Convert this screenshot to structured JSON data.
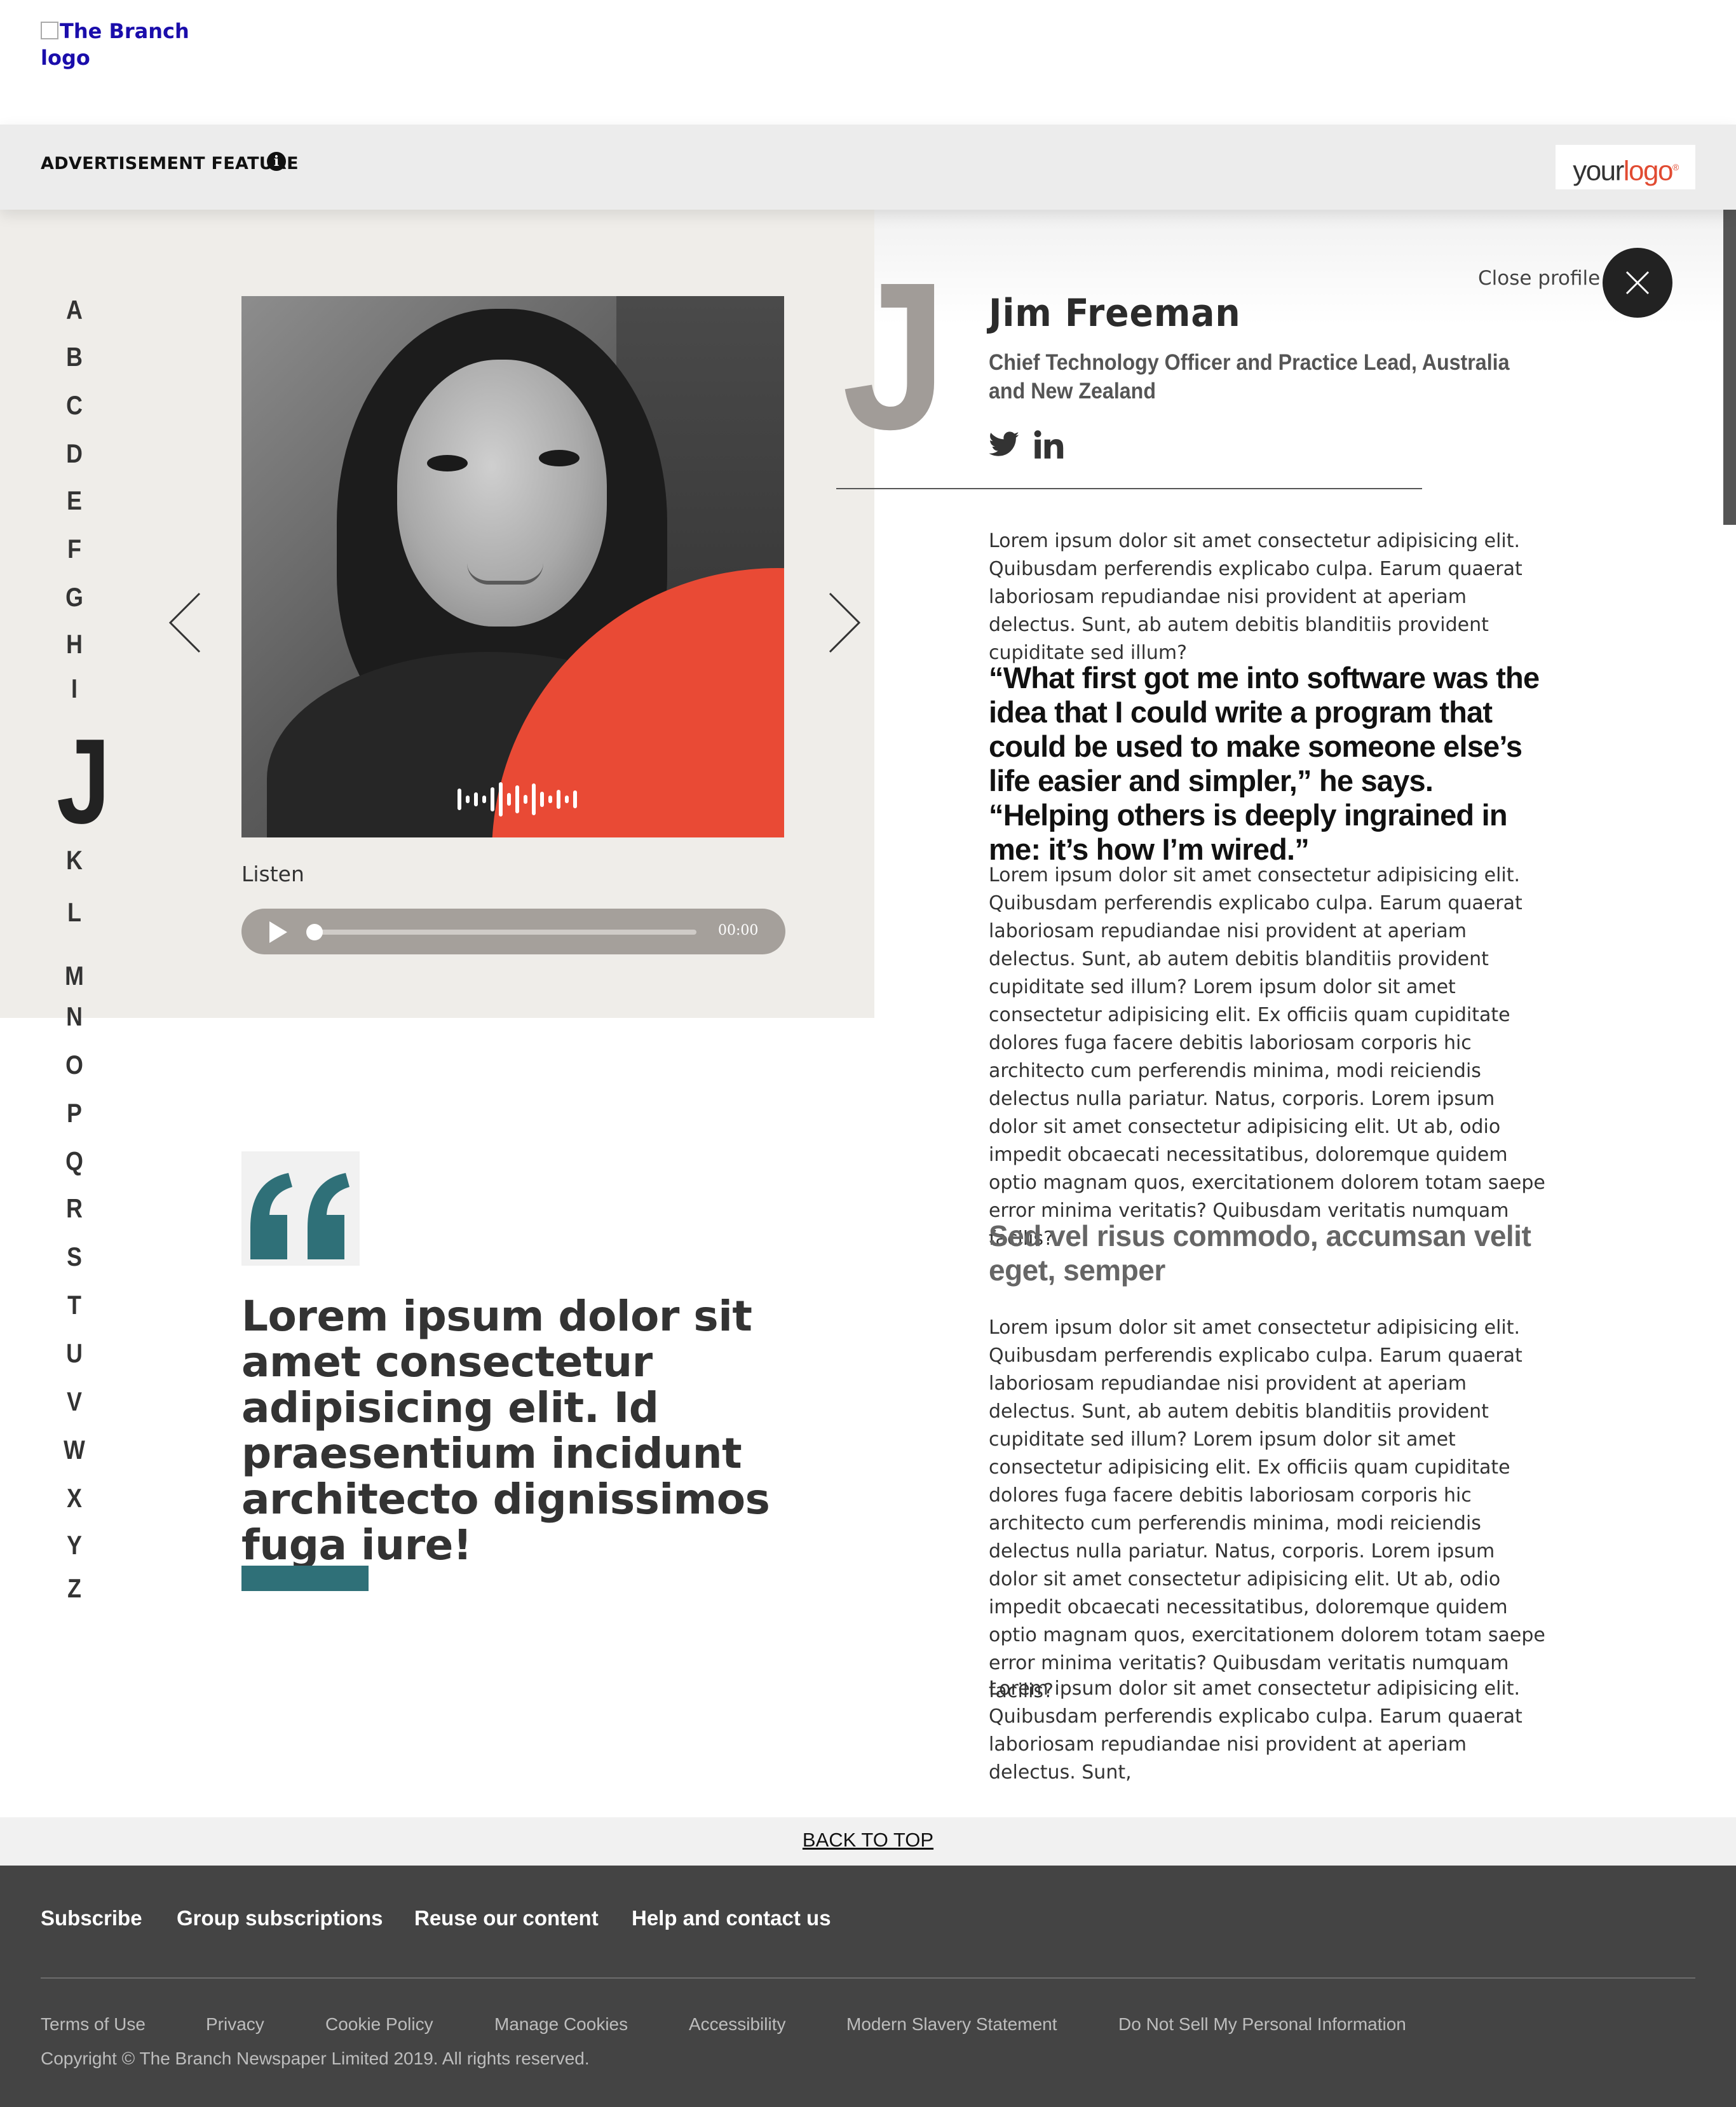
{
  "brand": {
    "logo_alt": "The Branch logo"
  },
  "adbar": {
    "label": "ADVERTISEMENT FEATURE",
    "info_icon": "i",
    "sponsor_logo_word1": "your",
    "sponsor_logo_word2": "logo",
    "sponsor_logo_mark": "®"
  },
  "alphabet": {
    "letters": [
      "A",
      "B",
      "C",
      "D",
      "E",
      "F",
      "G",
      "H",
      "I",
      "J",
      "K",
      "L",
      "M",
      "N",
      "O",
      "P",
      "Q",
      "R",
      "S",
      "T",
      "U",
      "V",
      "W",
      "X",
      "Y",
      "Z"
    ],
    "selected": "J"
  },
  "profile": {
    "initial": "J",
    "name": "Jim Freeman",
    "title": "Chief Technology Officer and Practice Lead, Australia and New Zealand",
    "close_label": "Close profile",
    "social_icons": [
      "twitter-icon",
      "linkedin-icon"
    ],
    "photo_accent_color": "#e94a35"
  },
  "audio": {
    "listen_label": "Listen",
    "time": "00:00",
    "progress": 0
  },
  "article": {
    "intro": "Lorem ipsum dolor sit amet consectetur adipisicing elit. Quibusdam perferendis explicabo culpa. Earum quaerat laboriosam repudiandae nisi provident at aperiam delectus. Sunt, ab autem debitis blanditiis provident cupiditate sed illum?",
    "quote": "“What first got me into software was the idea that I could write a program that could be used to make someone else’s life easier and simpler,” he says. “Helping others is deeply ingrained in me: it’s how I’m wired.”",
    "para2": "Lorem ipsum dolor sit amet consectetur adipisicing elit. Quibusdam perferendis explicabo culpa. Earum quaerat laboriosam repudiandae nisi provident at aperiam delectus. Sunt, ab autem debitis blanditiis provident cupiditate sed illum? Lorem ipsum dolor sit amet consectetur adipisicing elit. Ex officiis quam cupiditate dolores fuga facere debitis laboriosam corporis hic architecto cum perferendis minima, modi reiciendis delectus nulla pariatur. Natus, corporis. Lorem ipsum dolor sit amet consectetur adipisicing elit. Ut ab, odio impedit obcaecati necessitatibus, doloremque quidem optio magnam quos, exercitationem dolorem totam saepe error minima veritatis? Quibusdam veritatis numquam facilis?",
    "subhead": "Sed vel risus commodo, accumsan velit eget, semper",
    "para3": "Lorem ipsum dolor sit amet consectetur adipisicing elit. Quibusdam perferendis explicabo culpa. Earum quaerat laboriosam repudiandae nisi provident at aperiam delectus. Sunt, ab autem debitis blanditiis provident cupiditate sed illum? Lorem ipsum dolor sit amet consectetur adipisicing elit. Ex officiis quam cupiditate dolores fuga facere debitis laboriosam corporis hic architecto cum perferendis minima, modi reiciendis delectus nulla pariatur. Natus, corporis. Lorem ipsum dolor sit amet consectetur adipisicing elit. Ut ab, odio impedit obcaecati necessitatibus, doloremque quidem optio magnam quos, exercitationem dolorem totam saepe error minima veritatis? Quibusdam veritatis numquam facilis?",
    "para4": "Lorem ipsum dolor sit amet consectetur adipisicing elit. Quibusdam perferendis explicabo culpa. Earum quaerat laboriosam repudiandae nisi provident at aperiam delectus. Sunt,"
  },
  "pullquote": {
    "text": "Lorem ipsum dolor sit amet consectetur adipisicing elit. Id praesentium incidunt architecto dignissimos fuga iure!",
    "accent_color": "#2f7078"
  },
  "back_to_top": "BACK TO TOP",
  "footer": {
    "nav": [
      "Subscribe",
      "Group subscriptions",
      "Reuse our content",
      "Help and contact us"
    ],
    "links": [
      "Terms of Use",
      "Privacy",
      "Cookie Policy",
      "Manage Cookies",
      "Accessibility",
      "Modern Slavery Statement",
      "Do Not Sell My Personal Information"
    ],
    "copyright": "Copyright © The Branch Newspaper Limited 2019. All rights reserved."
  }
}
